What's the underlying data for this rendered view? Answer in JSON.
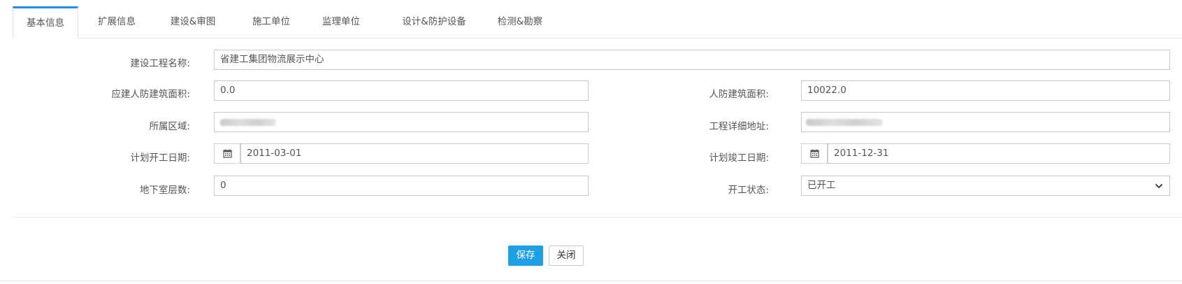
{
  "tabs": [
    {
      "label": "基本信息",
      "active": true
    },
    {
      "label": "扩展信息",
      "active": false
    },
    {
      "label": "建设&审图",
      "active": false
    },
    {
      "label": "施工单位",
      "active": false
    },
    {
      "label": "监理单位",
      "active": false
    },
    {
      "label": "设计&防护设备",
      "active": false
    },
    {
      "label": "检测&勘察",
      "active": false
    }
  ],
  "form": {
    "project_name": {
      "label": "建设工程名称:",
      "value": "省建工集团物流展示中心"
    },
    "required_area": {
      "label": "应建人防建筑面积:",
      "value": "0.0"
    },
    "civil_area": {
      "label": "人防建筑面积:",
      "value": "10022.0"
    },
    "region": {
      "label": "所属区域:",
      "value": ""
    },
    "address": {
      "label": "工程详细地址:",
      "value": ""
    },
    "plan_start": {
      "label": "计划开工日期:",
      "value": "2011-03-01",
      "icon": "calendar-icon"
    },
    "plan_finish": {
      "label": "计划竣工日期:",
      "value": "2011-12-31",
      "icon": "calendar-icon"
    },
    "basement_floors": {
      "label": "地下室层数:",
      "value": "0"
    },
    "start_status": {
      "label": "开工状态:",
      "value": "已开工",
      "icon": "chevron-down-icon"
    }
  },
  "actions": {
    "save_label": "保存",
    "close_label": "关闭"
  },
  "colors": {
    "accent": "#1e9fe6",
    "tab_indicator": "#2b8ee5",
    "border": "#c8c8c8"
  }
}
